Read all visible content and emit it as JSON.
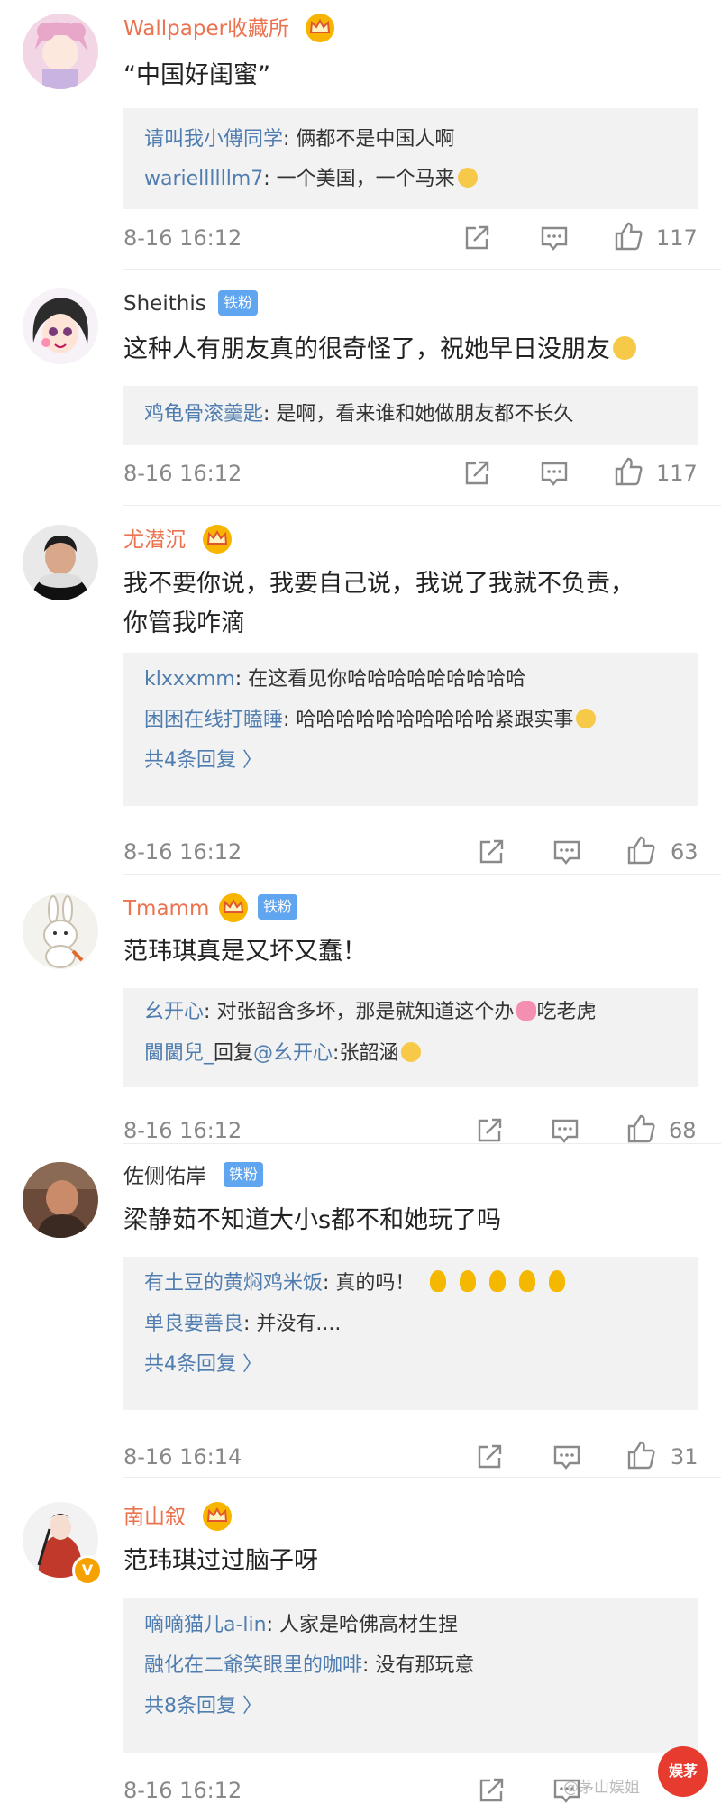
{
  "colors": {
    "orange_username": "#eb7350",
    "reply_username": "#507daf",
    "fan_badge": "#5fa5f0",
    "reply_bg": "#f2f2f2",
    "meta_gray": "#888888"
  },
  "comments": [
    {
      "username": "Wallpaper收藏所",
      "text": "“中国好闺蜜”",
      "replies": [
        {
          "user": "请叫我小傅同学",
          "text": ": 俩都不是中国人啊"
        },
        {
          "user": "wariellllllm7",
          "text": ": 一个美国，一个马来"
        }
      ],
      "more": "",
      "time": "8-16 16:12",
      "likes": "117"
    },
    {
      "username": "Sheithis",
      "badge": "铁粉",
      "text": "这种人有朋友真的很奇怪了，祝她早日没朋友",
      "replies": [
        {
          "user": "鸡龟骨滚羹匙",
          "text": ": 是啊，看来谁和她做朋友都不长久"
        }
      ],
      "more": "",
      "time": "8-16 16:12",
      "likes": "117"
    },
    {
      "username": "尤潜沉",
      "text": "我不要你说，我要自己说，我说了我就不负责，\n你管我咋滴",
      "replies": [
        {
          "user": "klxxxmm",
          "text": ": 在这看见你哈哈哈哈哈哈哈哈哈"
        },
        {
          "user": "困困在线打瞌睡",
          "text": ": 哈哈哈哈哈哈哈哈哈哈紧跟实事"
        }
      ],
      "more": "共4条回复 〉",
      "time": "8-16 16:12",
      "likes": "63"
    },
    {
      "username": "Tmamm",
      "badge": "铁粉",
      "text": "范玮琪真是又坏又蠢！",
      "replies": [
        {
          "user": "幺开心",
          "text": ": 对张韶含多坏，那是就知道这个办",
          "tail": "吃老虎"
        },
        {
          "user": "閫閫兒_",
          "text": "回复",
          "mention": "@幺开心",
          "text2": ":张韶涵"
        }
      ],
      "more": "",
      "time": "8-16 16:12",
      "likes": "68"
    },
    {
      "username": "佐侧佑岸",
      "badge": "铁粉",
      "text": "梁静茹不知道大小s都不和她玩了吗",
      "replies": [
        {
          "user": "有土豆的黄焖鸡米饭",
          "text": ": 真的吗！"
        },
        {
          "user": "单良要善良",
          "text": ": 并没有...."
        }
      ],
      "more": "共4条回复 〉",
      "time": "8-16 16:14",
      "likes": "31"
    },
    {
      "username": "南山叙",
      "text": "范玮琪过过脑子呀",
      "replies": [
        {
          "user": "嘀嘀猫儿a-lin",
          "text": ": 人家是哈佛高材生捏"
        },
        {
          "user": "融化在二爺笑眼里的咖啡",
          "text": ": 没有那玩意"
        }
      ],
      "more": "共8条回复 〉",
      "time": "8-16 16:12",
      "likes": ""
    }
  ],
  "watermark": {
    "text": "@茅山娱姐",
    "seal": "娱茅"
  }
}
